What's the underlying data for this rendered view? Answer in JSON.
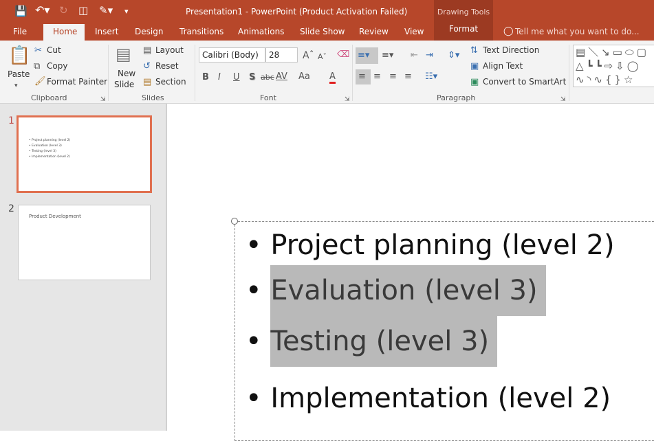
{
  "title": "Presentation1 - PowerPoint (Product Activation Failed)",
  "contextual_tab_group": "Drawing Tools",
  "tabs": [
    "File",
    "Home",
    "Insert",
    "Design",
    "Transitions",
    "Animations",
    "Slide Show",
    "Review",
    "View",
    "Format"
  ],
  "active_tab": "Home",
  "tell_me": "Tell me what you want to do...",
  "clipboard": {
    "paste": "Paste",
    "cut": "Cut",
    "copy": "Copy",
    "format_painter": "Format Painter",
    "label": "Clipboard"
  },
  "slides_group": {
    "new_slide_1": "New",
    "new_slide_2": "Slide",
    "layout": "Layout",
    "reset": "Reset",
    "section": "Section",
    "label": "Slides"
  },
  "font": {
    "name": "Calibri (Body)",
    "size": "28",
    "bold": "B",
    "italic": "I",
    "underline": "U",
    "shadow": "S",
    "strike": "abc",
    "spacing": "AV",
    "case": "Aa",
    "color_letter": "A",
    "label": "Font",
    "font_color": "#e02020"
  },
  "paragraph": {
    "text_direction": "Text Direction",
    "align_text": "Align Text",
    "smartart": "Convert to SmartArt",
    "label": "Paragraph"
  },
  "thumbnails": [
    {
      "number": "1",
      "lines": [
        "Project planning (level 2)",
        "Evaluation (level 3)",
        "Testing (level 3)",
        "Implementation (level 2)"
      ],
      "selected": true
    },
    {
      "number": "2",
      "title": "Product Development",
      "selected": false
    }
  ],
  "slide": {
    "bullets": [
      {
        "text": "Project planning (level 2)",
        "highlighted": false
      },
      {
        "text": "Evaluation (level 3)",
        "highlighted": true
      },
      {
        "text": "Testing (level 3)",
        "highlighted": true
      },
      {
        "text": "Implementation (level 2)",
        "highlighted": false
      }
    ]
  },
  "colors": {
    "accent": "#b7472a",
    "selection": "#e07050"
  }
}
